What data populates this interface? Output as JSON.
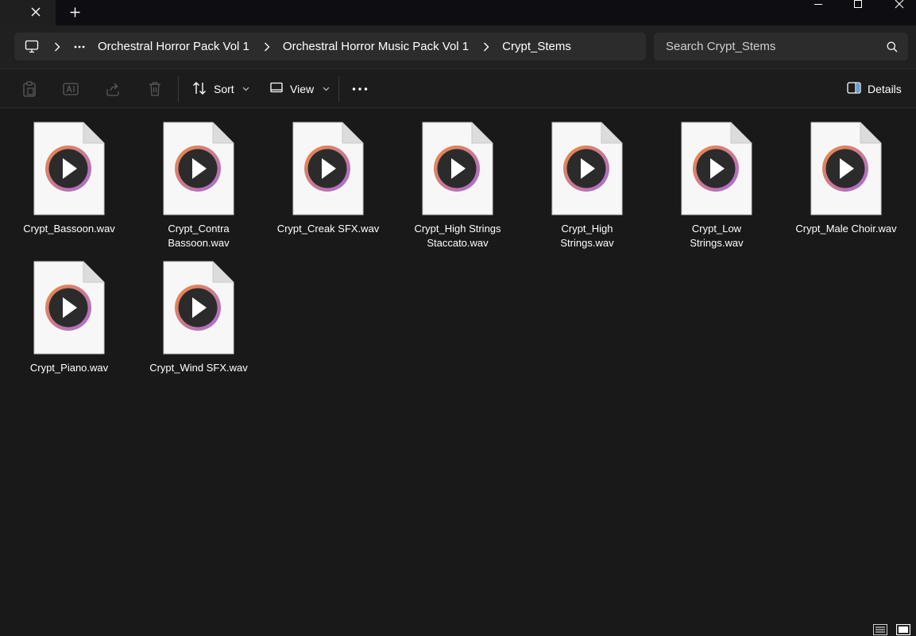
{
  "window": {
    "tab_close_icon": "close-icon",
    "new_tab_icon": "plus-icon"
  },
  "address": {
    "root_icon": "computer-icon",
    "overflow_icon": "more-horizontal-icon",
    "crumbs": [
      "Orchestral Horror Pack Vol 1",
      "Orchestral Horror Music Pack Vol 1",
      "Crypt_Stems"
    ]
  },
  "search": {
    "placeholder": "Search Crypt_Stems",
    "value": ""
  },
  "toolbar": {
    "sort_label": "Sort",
    "view_label": "View",
    "details_label": "Details"
  },
  "colors": {
    "accent_ring_start": "#f08a3c",
    "accent_ring_end": "#a56ae0",
    "play_disc": "#2b2b2b"
  },
  "files": [
    {
      "name": "Crypt_Bassoon.wav",
      "lines": [
        "Crypt_Bassoon.wav"
      ]
    },
    {
      "name": "Crypt_Contra Bassoon.wav",
      "lines": [
        "Crypt_Contra",
        "Bassoon.wav"
      ]
    },
    {
      "name": "Crypt_Creak SFX.wav",
      "lines": [
        "Crypt_Creak SFX.wav"
      ]
    },
    {
      "name": "Crypt_High Strings Staccato.wav",
      "lines": [
        "Crypt_High Strings",
        "Staccato.wav"
      ]
    },
    {
      "name": "Crypt_High Strings.wav",
      "lines": [
        "Crypt_High",
        "Strings.wav"
      ]
    },
    {
      "name": "Crypt_Low Strings.wav",
      "lines": [
        "Crypt_Low",
        "Strings.wav"
      ]
    },
    {
      "name": "Crypt_Male Choir.wav",
      "lines": [
        "Crypt_Male Choir.wav"
      ]
    },
    {
      "name": "Crypt_Piano.wav",
      "lines": [
        "Crypt_Piano.wav"
      ]
    },
    {
      "name": "Crypt_Wind SFX.wav",
      "lines": [
        "Crypt_Wind SFX.wav"
      ]
    }
  ]
}
